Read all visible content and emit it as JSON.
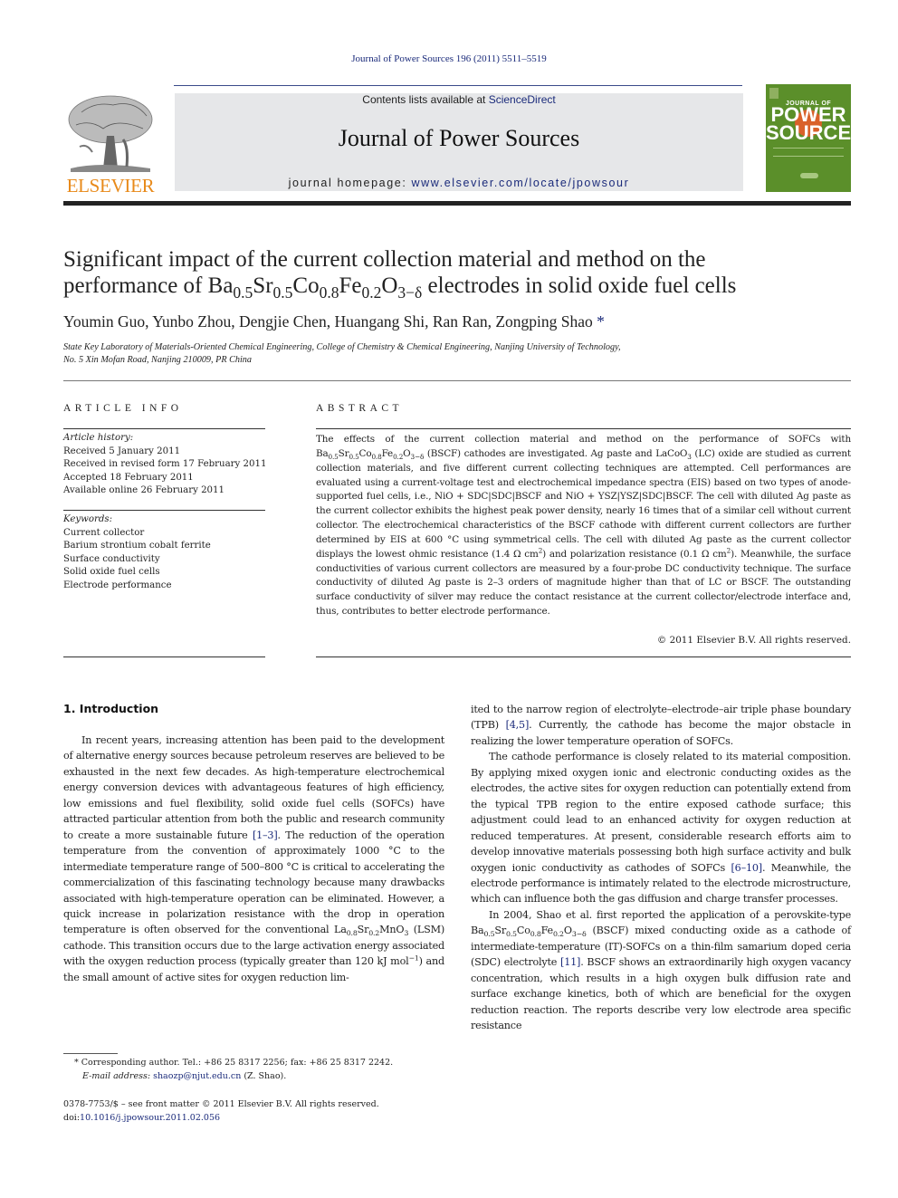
{
  "running_head": "Journal of Power Sources 196 (2011) 5511–5519",
  "masthead": {
    "publisher_logo_text": "ELSEVIER",
    "contents_prefix": "Contents lists available at ",
    "contents_link": "ScienceDirect",
    "journal_name": "Journal of Power Sources",
    "homepage_prefix": "journal homepage: ",
    "homepage_link": "www.elsevier.com/locate/jpowsour",
    "cover_top": "JOURNAL OF",
    "cover_title_1": "POWER",
    "cover_title_2": "SOURCES"
  },
  "colors": {
    "link": "#1a2a7a",
    "elsevier_orange": "#e88a1a",
    "masthead_bg": "#e6e7e9",
    "cover_green": "#5b8f2a",
    "cover_sun": "#d9612a"
  },
  "article": {
    "title_line1": "Significant impact of the current collection material and method on the",
    "title_line2_pre": "performance of ",
    "title_formula": {
      "Ba": "0.5",
      "Sr": "0.5",
      "Co": "0.8",
      "Fe": "0.2",
      "O": "3−δ"
    },
    "title_line2_post": " electrodes in solid oxide fuel cells",
    "authors": "Youmin Guo, Yunbo Zhou, Dengjie Chen, Huangang Shi, Ran Ran, Zongping Shao",
    "corresponding_mark": "*",
    "affiliation_line1": "State Key Laboratory of Materials-Oriented Chemical Engineering, College of Chemistry & Chemical Engineering, Nanjing University of Technology,",
    "affiliation_line2": "No. 5 Xin Mofan Road, Nanjing 210009, PR China"
  },
  "article_info": {
    "heading": "ARTICLE INFO",
    "history_label": "Article history:",
    "history": [
      "Received 5 January 2011",
      "Received in revised form 17 February 2011",
      "Accepted 18 February 2011",
      "Available online 26 February 2011"
    ],
    "keywords_label": "Keywords:",
    "keywords": [
      "Current collector",
      "Barium strontium cobalt ferrite",
      "Surface conductivity",
      "Solid oxide fuel cells",
      "Electrode performance"
    ]
  },
  "abstract": {
    "heading": "ABSTRACT",
    "part1": "The effects of the current collection material and method on the performance of SOFCs with ",
    "part2": " (BSCF) cathodes are investigated. Ag paste and LaCoO",
    "part2_sub": "3",
    "part3": " (LC) oxide are studied as current collection materials, and five different current collecting techniques are attempted. Cell performances are evaluated using a current-voltage test and electrochemical impedance spectra (EIS) based on two types of anode-supported fuel cells, i.e., NiO + SDC|SDC|BSCF and NiO + YSZ|YSZ|SDC|BSCF. The cell with diluted Ag paste as the current collector exhibits the highest peak power density, nearly 16 times that of a similar cell without current collector. The electrochemical characteristics of the BSCF cathode with different current collectors are further determined by EIS at 600 °C using symmetrical cells. The cell with diluted Ag paste as the current collector displays the lowest ohmic resistance (1.4 Ω cm",
    "part4": ") and polarization resistance (0.1 Ω cm",
    "part5": "). Meanwhile, the surface conductivities of various current collectors are measured by a four-probe DC conductivity technique. The surface conductivity of diluted Ag paste is 2–3 orders of magnitude higher than that of LC or BSCF. The outstanding surface conductivity of silver may reduce the contact resistance at the current collector/electrode interface and, thus, contributes to better electrode performance.",
    "sup2": "2",
    "copyright": "© 2011 Elsevier B.V. All rights reserved."
  },
  "introduction": {
    "heading": "1.  Introduction",
    "p1_a": "In recent years, increasing attention has been paid to the development of alternative energy sources because petroleum reserves are believed to be exhausted in the next few decades. As high-temperature electrochemical energy conversion devices with advantageous features of high efficiency, low emissions and fuel flexibility, solid oxide fuel cells (SOFCs) have attracted particular attention from both the public and research community to create a more sustainable future ",
    "ref_1_3": "[1–3]",
    "p1_b": ". The reduction of the operation temperature from the convention of approximately 1000 °C to the intermediate temperature range of 500–800 °C is critical to accelerating the commercialization of this fascinating technology because many drawbacks associated with high-temperature operation can be eliminated. However, a quick increase in polarization resistance with the drop in operation temperature is often observed for the conventional La",
    "lsm_la": "0.8",
    "lsm_sr_text": "Sr",
    "lsm_sr": "0.2",
    "lsm_mno": "MnO",
    "lsm_o": "3",
    "p1_c": " (LSM) cathode. This transition occurs due to the large activation energy associated with the oxygen reduction process (typically greater than 120 kJ mol",
    "p1_sup": "−1",
    "p1_d": ") and the small amount of active sites for oxygen reduction limited to the narrow region of electrolyte–electrode–air triple phase boundary (TPB) ",
    "ref_4_5": "[4,5]",
    "p1_e": ". Currently, the cathode has become the major obstacle in realizing the lower temperature operation of SOFCs.",
    "p2_a": "The cathode performance is closely related to its material composition. By applying mixed oxygen ionic and electronic conducting oxides as the electrodes, the active sites for oxygen reduction can potentially extend from the typical TPB region to the entire exposed cathode surface; this adjustment could lead to an enhanced activity for oxygen reduction at reduced temperatures. At present, considerable research efforts aim to develop innovative materials possessing both high surface activity and bulk oxygen ionic conductivity as cathodes of SOFCs ",
    "ref_6_10": "[6–10]",
    "p2_b": ". Meanwhile, the electrode performance is intimately related to the electrode microstructure, which can influence both the gas diffusion and charge transfer processes.",
    "p3_a": "In 2004, Shao et al. first reported the application of a perovskite-type ",
    "p3_b": " (BSCF) mixed conducting oxide as a cathode of intermediate-temperature (IT)-SOFCs on a thin-film samarium doped ceria (SDC) electrolyte ",
    "ref_11": "[11]",
    "p3_c": ". BSCF shows an extraordinarily high oxygen vacancy concentration, which results in a high oxygen bulk diffusion rate and surface exchange kinetics, both of which are beneficial for the oxygen reduction reaction. The reports describe very low electrode area specific resistance"
  },
  "footnote": {
    "mark": "*",
    "corresponding": " Corresponding author. Tel.: +86 25 8317 2256; fax: +86 25 8317 2242.",
    "email_label": "E-mail address:",
    "email": "shaozp@njut.edu.cn",
    "email_suffix": " (Z. Shao).",
    "front_matter": "0378-7753/$ – see front matter © 2011 Elsevier B.V. All rights reserved.",
    "doi_prefix": "doi:",
    "doi": "10.1016/j.jpowsour.2011.02.056"
  }
}
